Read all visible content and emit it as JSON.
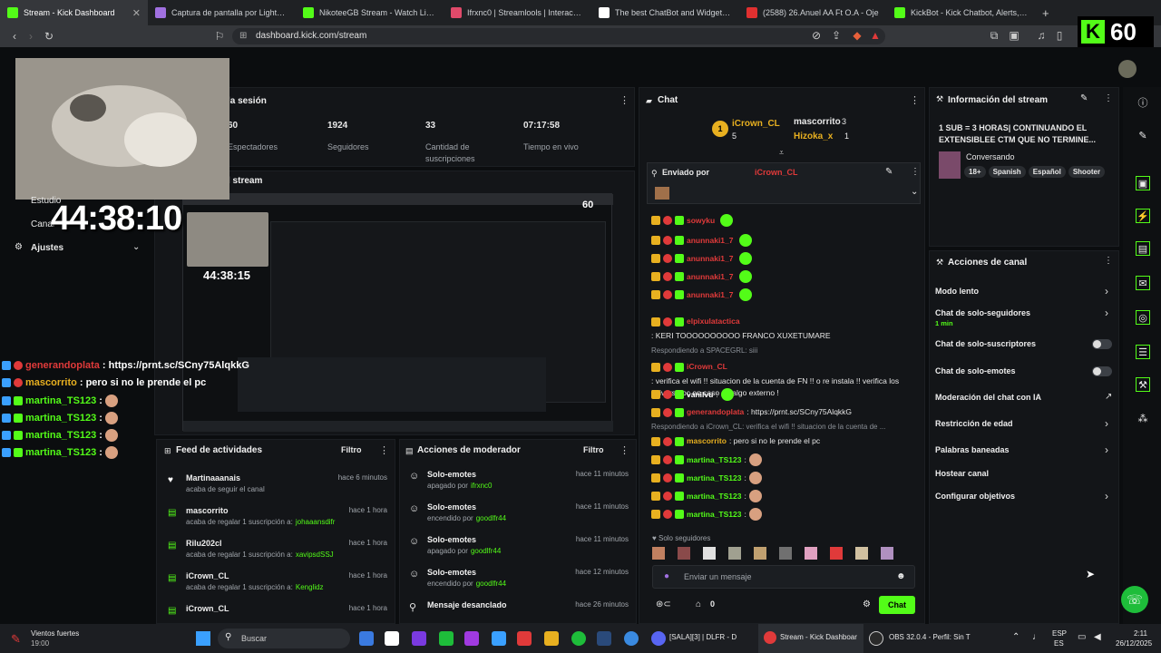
{
  "browser": {
    "tabs": [
      {
        "title": "Stream - Kick Dashboard",
        "color": "#53fc18",
        "active": true
      },
      {
        "title": "Captura de pantalla por Lightshot",
        "color": "#a070e0"
      },
      {
        "title": "NikoteeGB Stream - Watch Live on K",
        "color": "#53fc18"
      },
      {
        "title": "Ifrxnc0 | Streamlools | Interacciones",
        "color": "#e04a6a"
      },
      {
        "title": "The best ChatBot and Widgets for K",
        "color": "#ffffff"
      },
      {
        "title": "(2588) 26.Anuel AA Ft O.A - Oje",
        "color": "#e03030"
      },
      {
        "title": "KickBot - Kick Chatbot, Alerts, TTS, C",
        "color": "#53fc18"
      }
    ],
    "url": "dashboard.kick.com/stream",
    "viewer_overlay": "60"
  },
  "overlay": {
    "timer": "44:38:10",
    "menu_items": [
      "Estudio",
      "Canal",
      "Ajustes"
    ],
    "chat": [
      {
        "user": "generandoplata",
        "msg": ": https://prnt.sc/SCny75AlqkkG",
        "color": "#e03a3a"
      },
      {
        "user": "mascorrito",
        "msg": ": pero si no le prende el pc",
        "color": "#e8b020"
      },
      {
        "user": "martina_TS123",
        "msg": ":",
        "color": "#53fc18"
      },
      {
        "user": "martina_TS123",
        "msg": ":",
        "color": "#53fc18"
      },
      {
        "user": "martina_TS123",
        "msg": ":",
        "color": "#53fc18"
      },
      {
        "user": "martina_TS123",
        "msg": ":",
        "color": "#53fc18"
      }
    ]
  },
  "session": {
    "title": "la sesión",
    "stats": [
      {
        "value": "60",
        "label": "Espectadores"
      },
      {
        "value": "1924",
        "label": "Seguidores"
      },
      {
        "value": "33",
        "label": "Cantidad de suscripciones"
      },
      {
        "value": "07:17:58",
        "label": "Tiempo en vivo"
      }
    ],
    "preview_title": "l stream",
    "preview_timer": "44:38:15"
  },
  "chat": {
    "title": "Chat",
    "top_users": [
      {
        "name": "iCrown_CL",
        "count": "5",
        "rank": "1"
      },
      {
        "name": "mascorrito",
        "count": "3"
      },
      {
        "name": "Hizoka_x",
        "count": "1"
      }
    ],
    "pinned_label": "Enviado por",
    "pinned_user": "iCrown_CL",
    "messages": [
      {
        "user": "sowyku",
        "text": "",
        "color": "#e03a3a"
      },
      {
        "user": "anunnaki1_7",
        "text": "",
        "color": "#e03a3a"
      },
      {
        "user": "anunnaki1_7",
        "text": "",
        "color": "#e03a3a"
      },
      {
        "user": "anunnaki1_7",
        "text": "",
        "color": "#e03a3a"
      },
      {
        "user": "anunnaki1_7",
        "text": "",
        "color": "#e03a3a"
      },
      {
        "user": "elpixulatactica",
        "text": ": KERI TOOOOOOOOOO FRANCO XUXETUMARE",
        "color": "#e03a3a"
      },
      {
        "reply": "Respondiendo a SPACEGRL: siii"
      },
      {
        "user": "iCrown_CL",
        "text": ": verifica el wifi !! situacion de la cuenta de FN !! o re instala !! verifica los Drivers noc en caso de algo externo !",
        "color": "#e03a3a"
      },
      {
        "user": "vanilvu",
        "text": ":",
        "color": "#ffffff"
      },
      {
        "user": "generandoplata",
        "text": ": https://prnt.sc/SCny75AlqkkG",
        "color": "#e03a3a"
      },
      {
        "reply": "Respondiendo a iCrown_CL: verifica el wifi !! situacion de la cuenta de ..."
      },
      {
        "user": "mascorrito",
        "text": ": pero si no le prende el pc",
        "color": "#e8b020"
      },
      {
        "user": "martina_TS123",
        "text": ":",
        "color": "#53fc18"
      },
      {
        "user": "martina_TS123",
        "text": ":",
        "color": "#53fc18"
      },
      {
        "user": "martina_TS123",
        "text": ":",
        "color": "#53fc18"
      },
      {
        "user": "martina_TS123",
        "text": ":",
        "color": "#53fc18"
      }
    ],
    "followers_only": "Solo seguidores",
    "input_placeholder": "Enviar un mensaje",
    "send_label": "Chat",
    "points": "0"
  },
  "stream_info": {
    "title": "Información del stream",
    "stream_title": "1 SUB = 3 HORAS| CONTINUANDO EL EXTENSIBLEE CTM QUE NO TERMINE...",
    "category": "Conversando",
    "tags": [
      "18+",
      "Spanish",
      "Español",
      "Shooter"
    ]
  },
  "channel_actions": {
    "title": "Acciones de canal",
    "items": [
      {
        "label": "Modo lento",
        "kind": "arrow"
      },
      {
        "label": "Chat de solo-seguidores",
        "sub": "1 min",
        "kind": "arrow"
      },
      {
        "label": "Chat de solo-suscriptores",
        "kind": "toggle"
      },
      {
        "label": "Chat de solo-emotes",
        "kind": "toggle"
      },
      {
        "label": "Moderación del chat con IA",
        "kind": "ext"
      },
      {
        "label": "Restricción de edad",
        "kind": "arrow"
      },
      {
        "label": "Palabras baneadas",
        "kind": "arrow"
      },
      {
        "label": "Hostear canal",
        "kind": "none"
      },
      {
        "label": "Configurar objetivos",
        "kind": "arrow"
      }
    ]
  },
  "activity_feed": {
    "title": "Feed de actividades",
    "filter": "Filtro",
    "items": [
      {
        "name": "Martinaaanais",
        "sub": "acaba de seguir el canal",
        "time": "hace 6 minutos",
        "icon": "heart-icon"
      },
      {
        "name": "mascorrito",
        "sub": "acaba de regalar 1 suscripción a:",
        "target": "johaaansdifr",
        "time": "hace 1 hora",
        "icon": "gift-icon"
      },
      {
        "name": "Rilu202cl",
        "sub": "acaba de regalar 1 suscripción a:",
        "target": "xavipsdSSJ",
        "time": "hace 1 hora",
        "icon": "gift-icon"
      },
      {
        "name": "iCrown_CL",
        "sub": "acaba de regalar 1 suscripción a:",
        "target": "Kenglidz",
        "time": "hace 1 hora",
        "icon": "gift-icon"
      },
      {
        "name": "iCrown_CL",
        "sub": "",
        "time": "hace 1 hora",
        "icon": "gift-icon"
      }
    ]
  },
  "mod_actions": {
    "title": "Acciones de moderador",
    "filter": "Filtro",
    "items": [
      {
        "name": "Solo-emotes",
        "sub": "apagado por",
        "target": "ifrxnc0",
        "time": "hace 11 minutos"
      },
      {
        "name": "Solo-emotes",
        "sub": "encendido por",
        "target": "goodlfr44",
        "time": "hace 11 minutos"
      },
      {
        "name": "Solo-emotes",
        "sub": "apagado por",
        "target": "goodlfr44",
        "time": "hace 11 minutos"
      },
      {
        "name": "Solo-emotes",
        "sub": "encendido por",
        "target": "goodlfr44",
        "time": "hace 12 minutos"
      },
      {
        "name": "Mensaje desanclado",
        "sub": "",
        "time": "hace 26 minutos"
      }
    ]
  },
  "taskbar": {
    "weather": "Vientos fuertes",
    "weather_time": "19:00",
    "search": "Buscar",
    "apps": [
      "[SALA][3] | DLFR - D",
      "Stream - Kick Dashboar",
      "OBS 32.0.4 - Perfil: Sin T"
    ],
    "lang": "ESP",
    "lang2": "ES",
    "time": "2:11",
    "date": "26/12/2025"
  },
  "colors": {
    "accent": "#53fc18",
    "bg": "#0b0d0f",
    "panel": "#131518"
  }
}
